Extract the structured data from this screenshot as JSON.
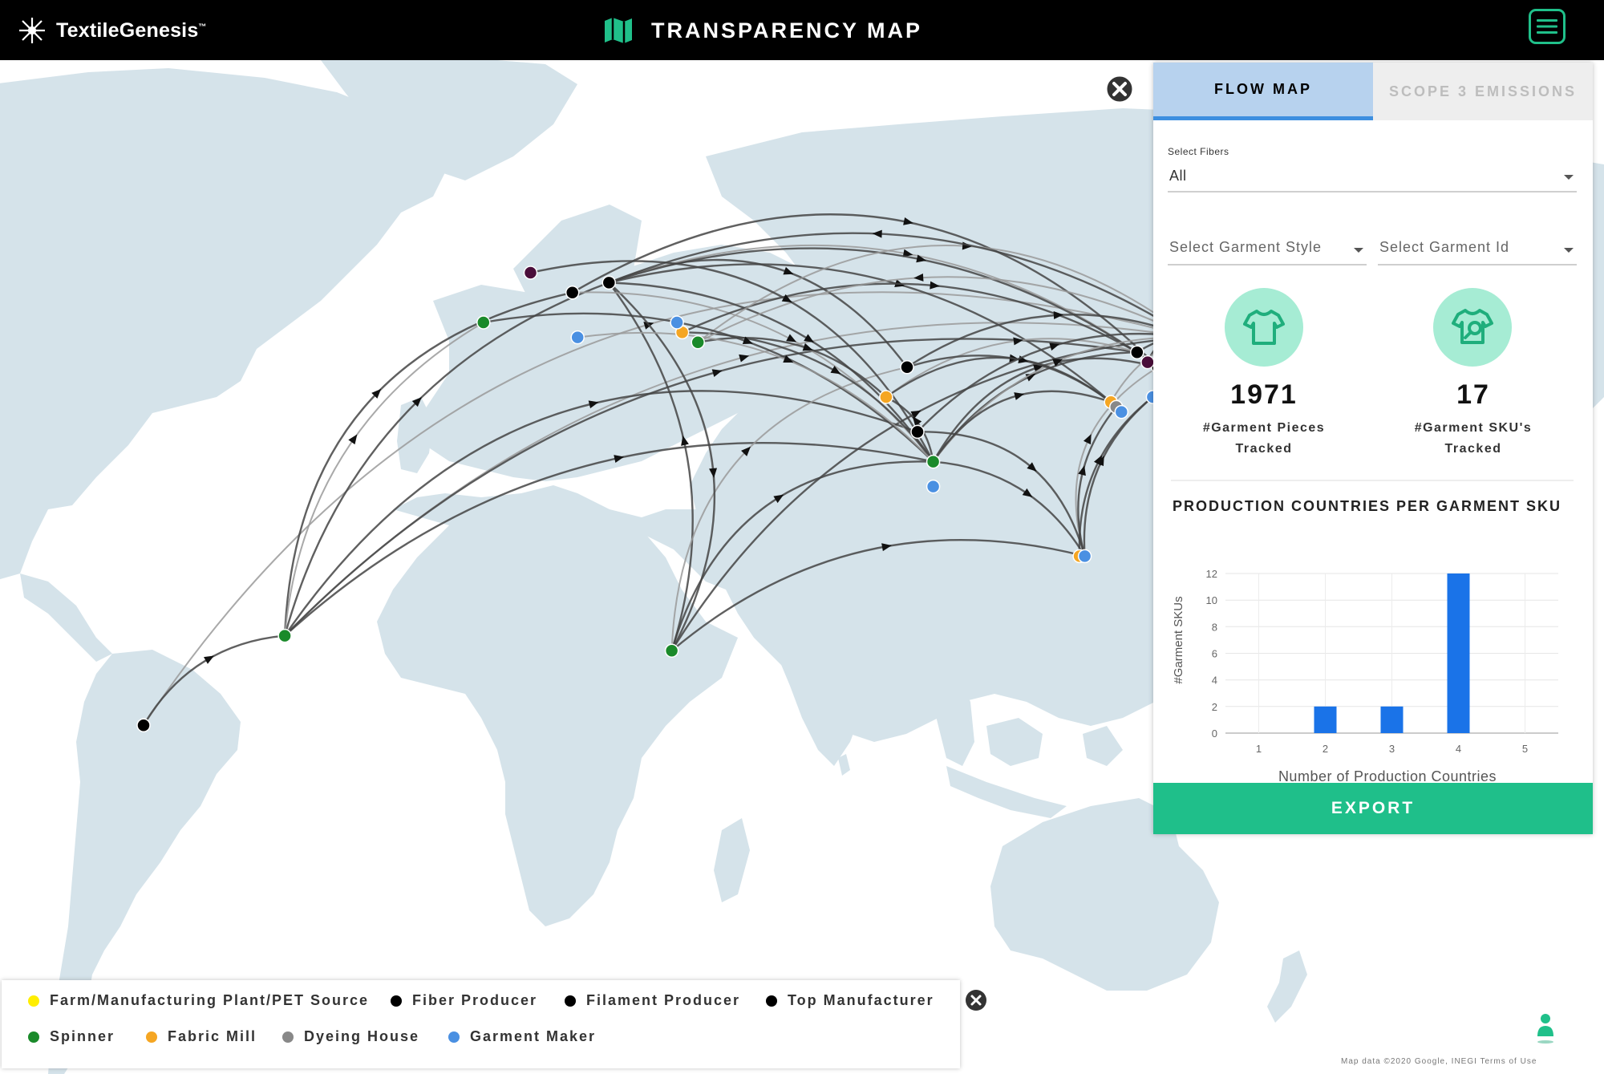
{
  "header": {
    "brand": "TextileGenesis",
    "brand_tm": "™",
    "title": "TRANSPARENCY MAP",
    "brand_icon": "asterisk-logo-icon",
    "title_icon": "map-icon",
    "menu_icon": "hamburger-menu-icon"
  },
  "panel": {
    "tabs": [
      {
        "label": "FLOW MAP",
        "active": true
      },
      {
        "label": "SCOPE 3 EMISSIONS",
        "active": false
      }
    ],
    "fibers": {
      "label": "Select Fibers",
      "value": "All"
    },
    "garment_style": {
      "placeholder": "Select Garment Style"
    },
    "garment_id": {
      "placeholder": "Select Garment Id"
    },
    "stats": [
      {
        "value": "1971",
        "label_line1": "#Garment Pieces",
        "label_line2": "Tracked",
        "icon": "tshirt-icon"
      },
      {
        "value": "17",
        "label_line1": "#Garment SKU's",
        "label_line2": "Tracked",
        "icon": "tshirt-search-icon"
      }
    ],
    "export_label": "EXPORT"
  },
  "chart_data": {
    "type": "bar",
    "title": "PRODUCTION COUNTRIES PER GARMENT SKU",
    "xlabel": "Number of Production Countries",
    "ylabel": "#Garment SKUs",
    "categories": [
      "1",
      "2",
      "3",
      "4",
      "5"
    ],
    "values": [
      0,
      2,
      2,
      12,
      0
    ],
    "ylim": [
      0,
      12
    ],
    "yticks": [
      "0",
      "2",
      "4",
      "6",
      "8",
      "10",
      "12"
    ],
    "grid": true,
    "bar_color": "#1a73e8"
  },
  "legend": {
    "items": [
      {
        "label": "Farm/Manufacturing Plant/PET Source",
        "color": "#ffee00"
      },
      {
        "label": "Fiber Producer",
        "color": "#000000"
      },
      {
        "label": "Filament Producer",
        "color": "#000000"
      },
      {
        "label": "Top Manufacturer",
        "color": "#000000"
      },
      {
        "label": "Spinner",
        "color": "#1a8a2a"
      },
      {
        "label": "Fabric Mill",
        "color": "#f5a623"
      },
      {
        "label": "Dyeing House",
        "color": "#888888"
      },
      {
        "label": "Garment Maker",
        "color": "#4a90e2"
      }
    ]
  },
  "map": {
    "attribution": "Map data ©2020 Google, INEGI    Terms of Use",
    "land_color": "#d5e3ea",
    "nodes": [
      {
        "type": "Spinner",
        "color": "#1a8a2a",
        "lon": -46,
        "lat": -23
      },
      {
        "type": "Spinner",
        "color": "#1a8a2a",
        "lon": 28,
        "lat": -26
      },
      {
        "type": "Spinner",
        "color": "#1a8a2a",
        "lon": 78,
        "lat": 12
      },
      {
        "type": "Spinner",
        "color": "#1a8a2a",
        "lon": 127,
        "lat": 37
      },
      {
        "type": "Spinner",
        "color": "#1a8a2a",
        "lon": -8,
        "lat": 40
      },
      {
        "type": "Spinner",
        "color": "#1a8a2a",
        "lon": 33,
        "lat": 36
      },
      {
        "type": "Fiber Producer",
        "color": "#000000",
        "lon": -73,
        "lat": -41
      },
      {
        "type": "Fiber Producer",
        "color": "#000000",
        "lon": 16,
        "lat": 48
      },
      {
        "type": "Fiber Producer",
        "color": "#000000",
        "lon": 9,
        "lat": 46
      },
      {
        "type": "Filament Producer",
        "color": "#000000",
        "lon": 73,
        "lat": 31
      },
      {
        "type": "Top Manufacturer",
        "color": "#000000",
        "lon": 117,
        "lat": 34
      },
      {
        "type": "Top Manufacturer",
        "color": "#000000",
        "lon": 121,
        "lat": 31
      },
      {
        "type": "Top Manufacturer",
        "color": "#000000",
        "lon": 75,
        "lat": 18
      },
      {
        "type": "Farm/Manufacturing Plant/PET Source",
        "color": "#4a0e3a",
        "lon": 1,
        "lat": 50
      },
      {
        "type": "Farm/Manufacturing Plant/PET Source",
        "color": "#4a0e3a",
        "lon": 119,
        "lat": 32
      },
      {
        "type": "Fabric Mill",
        "color": "#f5a623",
        "lon": 30,
        "lat": 38
      },
      {
        "type": "Fabric Mill",
        "color": "#f5a623",
        "lon": 69,
        "lat": 25
      },
      {
        "type": "Fabric Mill",
        "color": "#f5a623",
        "lon": 112,
        "lat": 24
      },
      {
        "type": "Fabric Mill",
        "color": "#f5a623",
        "lon": 126,
        "lat": 38
      },
      {
        "type": "Fabric Mill",
        "color": "#f5a623",
        "lon": 106,
        "lat": -7
      },
      {
        "type": "Dyeing House",
        "color": "#888888",
        "lon": 113,
        "lat": 23
      },
      {
        "type": "Garment Maker",
        "color": "#4a90e2",
        "lon": 10,
        "lat": 37
      },
      {
        "type": "Garment Maker",
        "color": "#4a90e2",
        "lon": 29,
        "lat": 40
      },
      {
        "type": "Garment Maker",
        "color": "#4a90e2",
        "lon": 78,
        "lat": 7
      },
      {
        "type": "Garment Maker",
        "color": "#4a90e2",
        "lon": 120,
        "lat": 25
      },
      {
        "type": "Garment Maker",
        "color": "#4a90e2",
        "lon": 139,
        "lat": 36
      },
      {
        "type": "Garment Maker",
        "color": "#4a90e2",
        "lon": 107,
        "lat": -7
      },
      {
        "type": "Garment Maker",
        "color": "#4a90e2",
        "lon": 114,
        "lat": 22
      }
    ],
    "flows": [
      [
        6,
        3
      ],
      [
        6,
        0
      ],
      [
        0,
        7
      ],
      [
        0,
        8
      ],
      [
        0,
        3
      ],
      [
        0,
        2
      ],
      [
        0,
        12
      ],
      [
        0,
        10
      ],
      [
        0,
        4
      ],
      [
        1,
        2
      ],
      [
        1,
        7
      ],
      [
        1,
        26
      ],
      [
        1,
        9
      ],
      [
        1,
        3
      ],
      [
        7,
        2
      ],
      [
        7,
        9
      ],
      [
        7,
        10
      ],
      [
        7,
        11
      ],
      [
        7,
        1
      ],
      [
        7,
        17
      ],
      [
        8,
        2
      ],
      [
        8,
        11
      ],
      [
        15,
        10
      ],
      [
        15,
        2
      ],
      [
        5,
        3
      ],
      [
        5,
        16
      ],
      [
        2,
        10
      ],
      [
        2,
        11
      ],
      [
        2,
        3
      ],
      [
        2,
        26
      ],
      [
        2,
        17
      ],
      [
        2,
        16
      ],
      [
        16,
        10
      ],
      [
        16,
        20
      ],
      [
        9,
        3
      ],
      [
        9,
        17
      ],
      [
        26,
        11
      ],
      [
        26,
        20
      ],
      [
        10,
        25
      ],
      [
        3,
        25
      ],
      [
        3,
        5
      ],
      [
        3,
        7
      ],
      [
        13,
        2
      ],
      [
        4,
        2
      ],
      [
        21,
        2
      ],
      [
        14,
        3
      ],
      [
        18,
        3
      ],
      [
        12,
        3
      ],
      [
        17,
        25
      ],
      [
        26,
        24
      ],
      [
        19,
        24
      ],
      [
        12,
        26
      ]
    ]
  }
}
